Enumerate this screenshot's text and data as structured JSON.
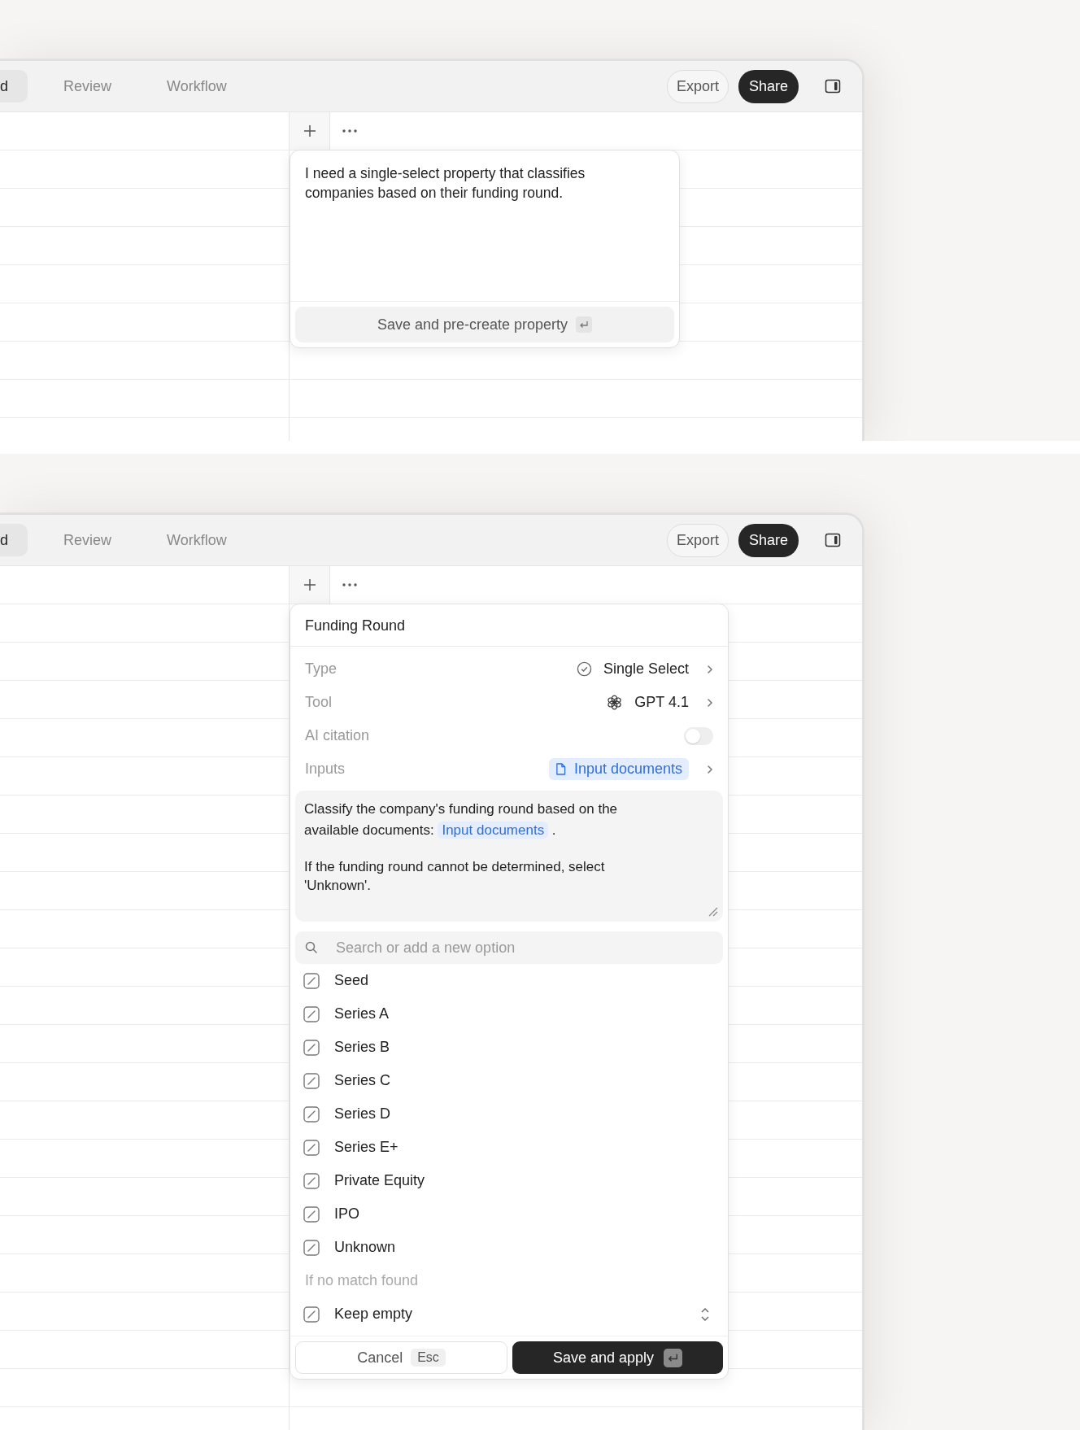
{
  "panels": [
    {
      "kind": "prompt",
      "tabs": [
        {
          "label": "d",
          "selected": true
        },
        {
          "label": "Review",
          "selected": false
        },
        {
          "label": "Workflow",
          "selected": false
        }
      ],
      "export_button": "Export",
      "share_button": "Share",
      "popup": {
        "text": "I need a single-select property that classifies companies based on their funding round.",
        "button": "Save and pre-create property"
      }
    },
    {
      "kind": "property",
      "tabs": [
        {
          "label": "d",
          "selected": true
        },
        {
          "label": "Review",
          "selected": false
        },
        {
          "label": "Workflow",
          "selected": false
        }
      ],
      "export_button": "Export",
      "share_button": "Share",
      "popup": {
        "title": "Funding Round",
        "fields": [
          {
            "kind": "type",
            "label": "Type",
            "value": "Single Select"
          },
          {
            "kind": "model",
            "label": "Tool",
            "value": "GPT 4.1"
          },
          {
            "kind": "toggle",
            "label": "AI citation",
            "on": false
          },
          {
            "kind": "source",
            "label": "Inputs",
            "value": "Input documents"
          }
        ],
        "prompt": {
          "segments": [
            {
              "kind": "text",
              "text": "Classify the company's funding round based on the available documents: "
            },
            {
              "kind": "chip",
              "text": "Input documents"
            },
            {
              "kind": "text",
              "text": " ."
            }
          ],
          "note": "If the funding round cannot be determined, select 'Unknown'."
        },
        "search": {
          "placeholder": "Search or add a new option"
        },
        "options": [
          "Seed",
          "Series A",
          "Series B",
          "Series C",
          "Series D",
          "Series E+",
          "Private Equity",
          "IPO",
          "Unknown"
        ],
        "fallback": {
          "label": "If no match found",
          "value": "Keep empty"
        },
        "cancel_button": "Cancel",
        "cancel_key": "Esc",
        "save_button": "Save and apply"
      }
    }
  ]
}
